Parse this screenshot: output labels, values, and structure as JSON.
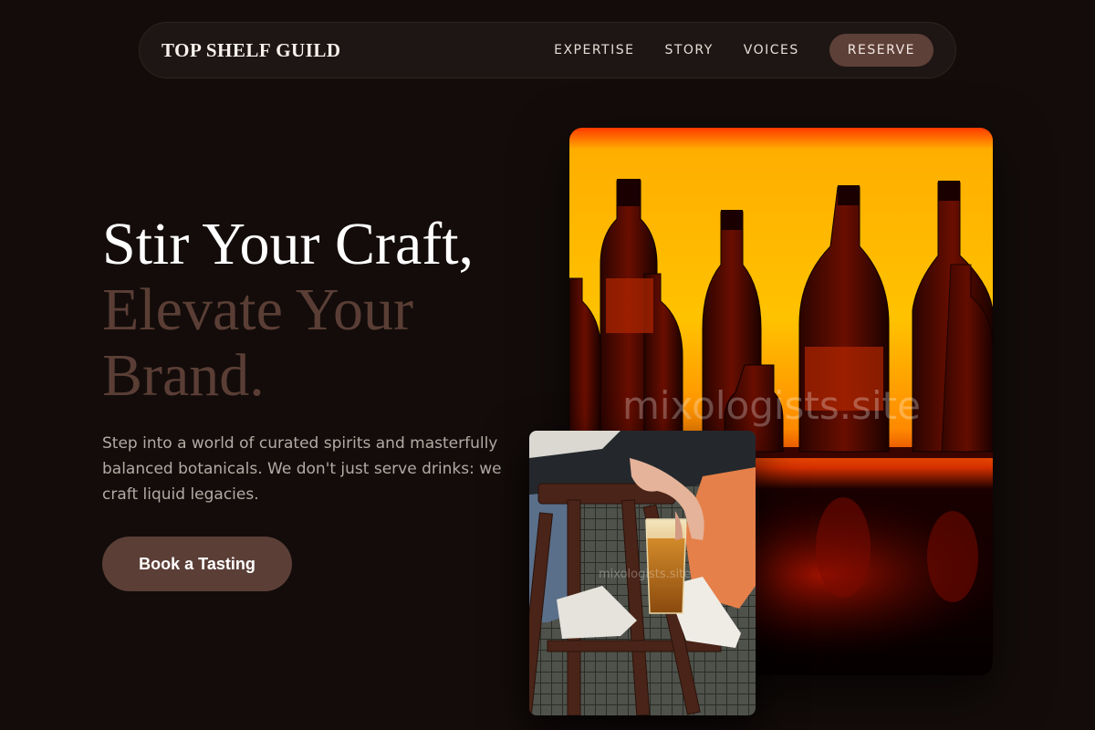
{
  "brand": {
    "name": "TOP SHELF GUILD"
  },
  "nav": {
    "links": [
      "EXPERTISE",
      "STORY",
      "VOICES"
    ],
    "cta_label": "RESERVE"
  },
  "hero": {
    "headline_line1": "Stir Your Craft,",
    "headline_line2": "Elevate Your",
    "headline_line3": "Brand.",
    "lead": "Step into a world of curated spirits and masterfully balanced botanicals. We don't just serve drinks: we craft liquid legacies.",
    "cta_label": "Book a Tasting"
  },
  "images": {
    "main_alt": "Backlit liquor bottles on a bar shelf",
    "secondary_alt": "Person holding a glass of beer on a bar stool",
    "watermark": "mixologists.site"
  },
  "colors": {
    "background": "#130c0a",
    "nav_bg": "#1e1614",
    "accent": "#5b3f37",
    "headline_muted": "#5a3e35",
    "body_text": "#b4aaa4"
  }
}
